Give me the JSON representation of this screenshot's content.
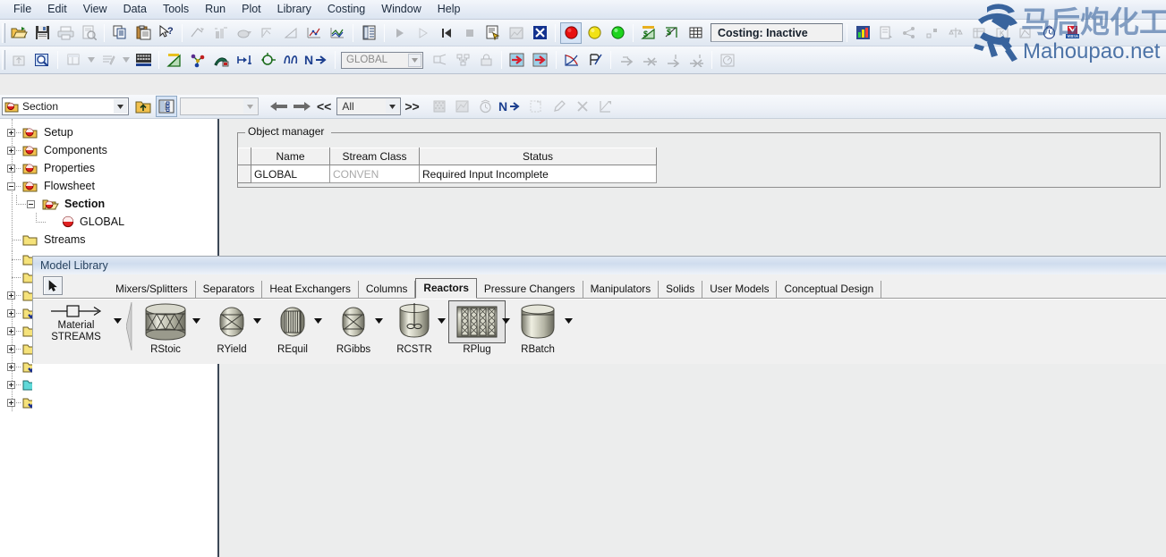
{
  "menubar": {
    "items": [
      "File",
      "Edit",
      "View",
      "Data",
      "Tools",
      "Run",
      "Plot",
      "Library",
      "Costing",
      "Window",
      "Help"
    ]
  },
  "toolbar1": {
    "buttons": [
      {
        "name": "open-file-icon",
        "enabled": true
      },
      {
        "name": "save-icon",
        "enabled": true
      },
      {
        "name": "print-icon",
        "enabled": false
      },
      {
        "name": "print-preview-icon",
        "enabled": false
      },
      {
        "name": "copy-icon",
        "enabled": true
      },
      {
        "name": "paste-icon",
        "enabled": true
      },
      {
        "name": "help-pointer-icon",
        "enabled": true
      },
      {
        "name": "stream-results-icon",
        "enabled": false
      },
      {
        "name": "block-results-icon",
        "enabled": false
      },
      {
        "name": "utility-icon",
        "enabled": false
      },
      {
        "name": "plot-wizard-icon",
        "enabled": false
      },
      {
        "name": "triangle-plot-icon",
        "enabled": false
      },
      {
        "name": "plot-curve-icon",
        "enabled": false
      },
      {
        "name": "plot-multi-icon",
        "enabled": false
      },
      {
        "name": "data-browser-icon",
        "enabled": true
      },
      {
        "name": "next-run-icon",
        "enabled": false
      },
      {
        "name": "step-icon",
        "enabled": false
      },
      {
        "name": "reinitialize-icon",
        "enabled": true
      },
      {
        "name": "stop-icon",
        "enabled": false
      },
      {
        "name": "control-panel-icon",
        "enabled": true
      },
      {
        "name": "report-icon",
        "enabled": false
      },
      {
        "name": "close-x-icon",
        "enabled": true
      },
      {
        "name": "status-red-icon",
        "enabled": true
      },
      {
        "name": "status-yellow-icon",
        "enabled": true
      },
      {
        "name": "status-green-icon",
        "enabled": true
      },
      {
        "name": "costing-triangle-icon",
        "enabled": true
      },
      {
        "name": "economics-icon",
        "enabled": true
      },
      {
        "name": "grid-icon",
        "enabled": true
      }
    ],
    "costing_status": "Costing: Inactive",
    "right_buttons": [
      {
        "name": "activated-economics-icon",
        "enabled": true
      },
      {
        "name": "report-export-icon",
        "enabled": false
      },
      {
        "name": "share-nodes-icon",
        "enabled": false
      },
      {
        "name": "align-icon",
        "enabled": false
      },
      {
        "name": "balance-icon",
        "enabled": false
      },
      {
        "name": "table-icon",
        "enabled": false
      },
      {
        "name": "kvalue-icon",
        "enabled": false
      },
      {
        "name": "flowsheet-icon",
        "enabled": false
      },
      {
        "name": "clock-icon",
        "enabled": true
      },
      {
        "name": "vista-badge-icon",
        "enabled": true
      }
    ]
  },
  "toolbar2": {
    "buttons_left": [
      {
        "name": "upload-icon",
        "enabled": false
      },
      {
        "name": "zoom-region-icon",
        "enabled": true
      },
      {
        "name": "table-dropdown-icon",
        "enabled": false
      },
      {
        "name": "annotate-dropdown-icon",
        "enabled": false
      },
      {
        "name": "keyboard-grid-icon",
        "enabled": true
      },
      {
        "name": "property-sets-icon",
        "enabled": true
      },
      {
        "name": "molecule-icon",
        "enabled": true
      },
      {
        "name": "paint-icon",
        "enabled": true
      },
      {
        "name": "heat-stream-icon",
        "enabled": true
      },
      {
        "name": "work-stream-icon",
        "enabled": true
      },
      {
        "name": "curve-icon",
        "enabled": true
      },
      {
        "name": "next-icon",
        "enabled": true
      }
    ],
    "global_value": "GLOBAL",
    "buttons_right": [
      {
        "name": "resize-icon",
        "enabled": false
      },
      {
        "name": "hierarchy-icon",
        "enabled": false
      },
      {
        "name": "lock-icon",
        "enabled": false
      },
      {
        "name": "import-stream-icon",
        "enabled": true
      },
      {
        "name": "export-stream-icon",
        "enabled": true
      },
      {
        "name": "convergence-curve-icon",
        "enabled": true
      },
      {
        "name": "check-results-icon",
        "enabled": true
      },
      {
        "name": "arrow-right-icon",
        "enabled": false
      },
      {
        "name": "arrow-converge-icon",
        "enabled": false
      },
      {
        "name": "arrow-down-icon",
        "enabled": false
      },
      {
        "name": "arrow-merge-icon",
        "enabled": false
      },
      {
        "name": "gauge-icon",
        "enabled": false
      }
    ]
  },
  "logo": {
    "chinese_text": "马后炮化工",
    "site_text": "Mahoupao.net",
    "vista_badge": "VISTA",
    "color": "#2a5896"
  },
  "navbar": {
    "section_label": "Section",
    "blank_combo_value": "",
    "filter_value": "All",
    "prev_label": "◀",
    "next_label": "▶",
    "first_label": "<<",
    "last_label": ">>",
    "buttons": [
      {
        "name": "up-one-level-icon",
        "enabled": true
      },
      {
        "name": "show-tree-icon",
        "enabled": true,
        "pressed": true
      },
      {
        "name": "input-form-icon",
        "enabled": false
      },
      {
        "name": "results-form-icon",
        "enabled": false
      },
      {
        "name": "history-icon",
        "enabled": false
      },
      {
        "name": "next-input-icon",
        "enabled": true
      },
      {
        "name": "new-object-icon",
        "enabled": false
      },
      {
        "name": "edit-object-icon",
        "enabled": false
      },
      {
        "name": "delete-object-icon",
        "enabled": false
      },
      {
        "name": "rename-object-icon",
        "enabled": false
      }
    ]
  },
  "tree": {
    "nodes": [
      {
        "label": "Setup",
        "expander": "plus",
        "icon": "red-folder-icon",
        "indent": 0,
        "bold": false
      },
      {
        "label": "Components",
        "expander": "plus",
        "icon": "red-folder-icon",
        "indent": 0,
        "bold": false
      },
      {
        "label": "Properties",
        "expander": "plus",
        "icon": "red-folder-icon",
        "indent": 0,
        "bold": false
      },
      {
        "label": "Flowsheet",
        "expander": "minus",
        "icon": "red-folder-icon",
        "indent": 0,
        "bold": false
      },
      {
        "label": "Section",
        "expander": "minus",
        "icon": "open-folder-icon",
        "indent": 1,
        "bold": true
      },
      {
        "label": "GLOBAL",
        "expander": "none",
        "icon": "red-dot-icon",
        "indent": 2,
        "bold": false
      },
      {
        "label": "Streams",
        "expander": "none",
        "icon": "yellow-folder-icon",
        "indent": 0,
        "bold": false
      }
    ],
    "hidden_rows": [
      {
        "icon": "yellow-folder-icon",
        "expander": "none"
      },
      {
        "icon": "yellow-folder-icon",
        "expander": "none"
      },
      {
        "icon": "yellow-folder-icon",
        "expander": "plus"
      },
      {
        "icon": "check-folder-icon",
        "expander": "plus"
      },
      {
        "icon": "yellow-folder-icon",
        "expander": "plus"
      },
      {
        "icon": "yellow-folder-icon",
        "expander": "plus"
      },
      {
        "icon": "check-folder-icon",
        "expander": "plus"
      },
      {
        "icon": "cyan-folder-icon",
        "expander": "plus"
      },
      {
        "icon": "check-folder-icon",
        "expander": "plus"
      }
    ]
  },
  "object_manager": {
    "title": "Object manager",
    "columns": [
      "Name",
      "Stream Class",
      "Status"
    ],
    "rows": [
      {
        "name": "GLOBAL",
        "stream_class": "CONVEN",
        "status": "Required Input Incomplete"
      }
    ]
  },
  "model_library": {
    "title": "Model Library",
    "tabs": [
      {
        "label": "Mixers/Splitters",
        "active": false
      },
      {
        "label": "Separators",
        "active": false
      },
      {
        "label": "Heat Exchangers",
        "active": false
      },
      {
        "label": "Columns",
        "active": false
      },
      {
        "label": "Reactors",
        "active": true
      },
      {
        "label": "Pressure Changers",
        "active": false
      },
      {
        "label": "Manipulators",
        "active": false
      },
      {
        "label": "Solids",
        "active": false
      },
      {
        "label": "User Models",
        "active": false
      },
      {
        "label": "Conceptual Design",
        "active": false
      }
    ],
    "stream_item": {
      "line1": "Material",
      "line2": "STREAMS",
      "icon": "material-stream-icon"
    },
    "models": [
      {
        "label": "RStoic",
        "icon": "rstoic-icon",
        "selected": false
      },
      {
        "label": "RYield",
        "icon": "ryield-icon",
        "selected": false
      },
      {
        "label": "REquil",
        "icon": "requil-icon",
        "selected": false
      },
      {
        "label": "RGibbs",
        "icon": "rgibbs-icon",
        "selected": false
      },
      {
        "label": "RCSTR",
        "icon": "rcstr-icon",
        "selected": false
      },
      {
        "label": "RPlug",
        "icon": "rplug-icon",
        "selected": true
      },
      {
        "label": "RBatch",
        "icon": "rbatch-icon",
        "selected": false
      }
    ],
    "select_tool": {
      "name": "arrow-select-tool",
      "label": ""
    }
  }
}
